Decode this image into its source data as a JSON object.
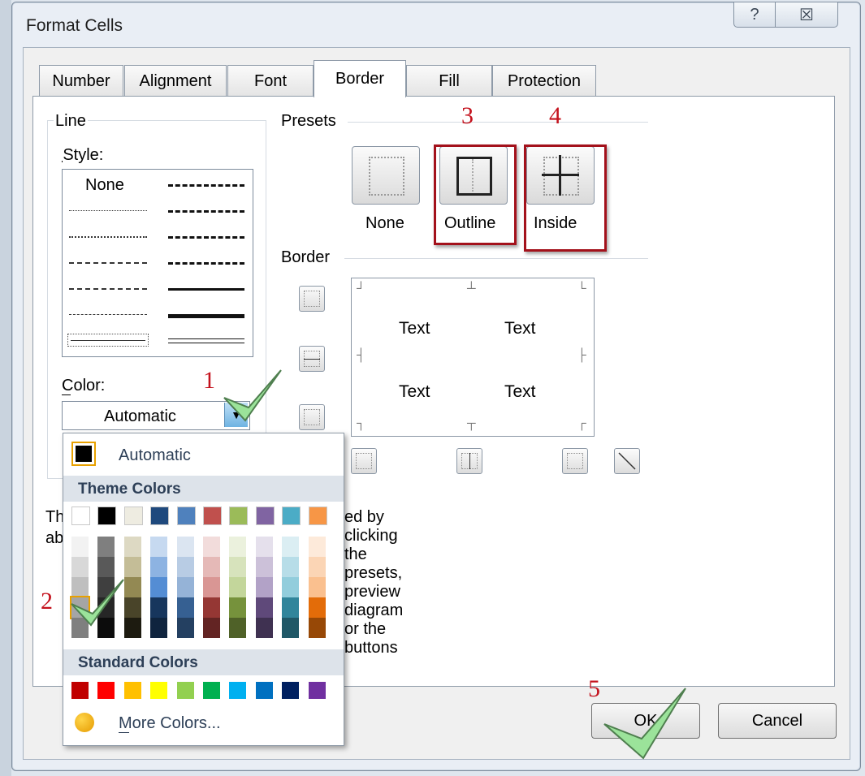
{
  "window": {
    "title": "Format Cells",
    "help_glyph": "?",
    "close_glyph": "☒"
  },
  "tabs": [
    {
      "label": "Number"
    },
    {
      "label": "Alignment"
    },
    {
      "label": "Font"
    },
    {
      "label": "Border"
    },
    {
      "label": "Fill"
    },
    {
      "label": "Protection"
    }
  ],
  "line": {
    "group_label": "Line",
    "style_label": "Style:",
    "style_none": "None",
    "color_label": "Color:",
    "color_value": "Automatic"
  },
  "presets": {
    "group_label": "Presets",
    "items": [
      {
        "label": "None"
      },
      {
        "label": "Outline"
      },
      {
        "label": "Inside"
      }
    ]
  },
  "border": {
    "group_label": "Border",
    "preview_texts": [
      "Text",
      "Text",
      "Text",
      "Text"
    ]
  },
  "hint_text": {
    "left": "Th",
    "left2": "ab",
    "right": "ed by clicking the presets, preview diagram or the buttons"
  },
  "color_popup": {
    "automatic": "Automatic",
    "theme_header": "Theme Colors",
    "standard_header": "Standard Colors",
    "more_colors": "More Colors...",
    "theme_top": [
      "#ffffff",
      "#000000",
      "#eeece1",
      "#1f497d",
      "#4f81bd",
      "#c0504d",
      "#9bbb59",
      "#8064a2",
      "#4bacc6",
      "#f79646"
    ],
    "theme_shades": [
      [
        "#f2f2f2",
        "#d8d8d8",
        "#bfbfbf",
        "#a5a5a5",
        "#7f7f7f"
      ],
      [
        "#7f7f7f",
        "#595959",
        "#3f3f3f",
        "#262626",
        "#0c0c0c"
      ],
      [
        "#ddd9c3",
        "#c4bd97",
        "#938953",
        "#494429",
        "#1d1b10"
      ],
      [
        "#c6d9f0",
        "#8db3e2",
        "#548dd4",
        "#17365d",
        "#0f243e"
      ],
      [
        "#dbe5f1",
        "#b8cce4",
        "#95b3d7",
        "#366092",
        "#244061"
      ],
      [
        "#f2dcdb",
        "#e5b9b7",
        "#d99694",
        "#953734",
        "#632423"
      ],
      [
        "#ebf1dd",
        "#d7e3bc",
        "#c3d69b",
        "#76923c",
        "#4f6128"
      ],
      [
        "#e5e0ec",
        "#ccc1d9",
        "#b2a2c7",
        "#5f497a",
        "#3f3151"
      ],
      [
        "#dbeef3",
        "#b7dde8",
        "#92cddc",
        "#31859b",
        "#205867"
      ],
      [
        "#fdeada",
        "#fbd5b5",
        "#fac08f",
        "#e36c09",
        "#974806"
      ]
    ],
    "standard": [
      "#c00000",
      "#ff0000",
      "#ffc000",
      "#ffff00",
      "#92d050",
      "#00b050",
      "#00b0f0",
      "#0070c0",
      "#002060",
      "#7030a0"
    ]
  },
  "annotations": {
    "n1": "1",
    "n2": "2",
    "n3": "3",
    "n4": "4",
    "n5": "5"
  },
  "buttons": {
    "ok": "OK",
    "cancel": "Cancel"
  },
  "colors": {
    "annotation_red": "#c4121d",
    "check_green": "#6fcf6a",
    "arrow_blue": "#6fb3e2"
  }
}
